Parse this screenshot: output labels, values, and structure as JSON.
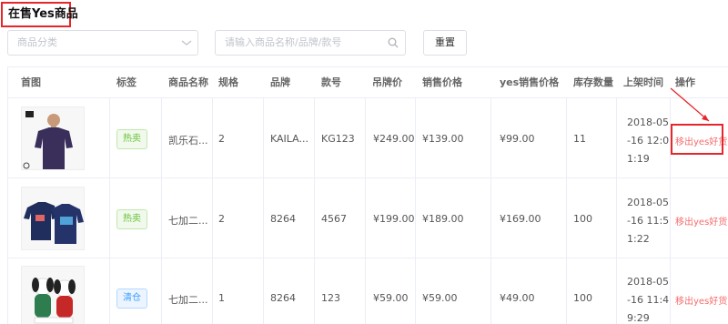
{
  "page": {
    "title": "在售Yes商品"
  },
  "filters": {
    "category_placeholder": "商品分类",
    "search_placeholder": "请输入商品名称/品牌/款号",
    "reset_label": "重置"
  },
  "table": {
    "headers": [
      "首图",
      "标签",
      "商品名称",
      "规格",
      "品牌",
      "款号",
      "吊牌价",
      "销售价格",
      "yes销售价格",
      "库存数量",
      "上架时间",
      "操作"
    ],
    "rows": [
      {
        "image": "purple-tshirt-model",
        "tag": "热卖",
        "tag_style": "green",
        "name": "凯乐石...",
        "spec": "2",
        "brand": "KAILA...",
        "style_no": "KG123",
        "tag_price": "¥249.00",
        "sale_price": "¥139.00",
        "yes_price": "¥99.00",
        "stock": "11",
        "time_l1": "2018-05",
        "time_l2": "-16 12:0",
        "time_l3": "1:19",
        "action": "移出yes好货"
      },
      {
        "image": "navy-tshirts",
        "tag": "热卖",
        "tag_style": "green",
        "name": "七加二...",
        "spec": "2",
        "brand": "8264",
        "style_no": "4567",
        "tag_price": "¥199.00",
        "sale_price": "¥189.00",
        "yes_price": "¥169.00",
        "stock": "100",
        "time_l1": "2018-05",
        "time_l2": "-16 11:5",
        "time_l3": "1:22",
        "action": "移出yes好货"
      },
      {
        "image": "plush-dogs",
        "tag": "清仓",
        "tag_style": "blue",
        "name": "七加二...",
        "spec": "1",
        "brand": "8264",
        "style_no": "123",
        "tag_price": "¥59.00",
        "sale_price": "¥59.00",
        "yes_price": "¥49.00",
        "stock": "100",
        "time_l1": "2018-05",
        "time_l2": "-16 11:4",
        "time_l3": "9:29",
        "action": "移出yes好货"
      }
    ]
  },
  "colors": {
    "accent_red": "#e5262b",
    "action": "#f56c6c",
    "tag_green": "#67c23a",
    "tag_blue": "#409eff"
  }
}
